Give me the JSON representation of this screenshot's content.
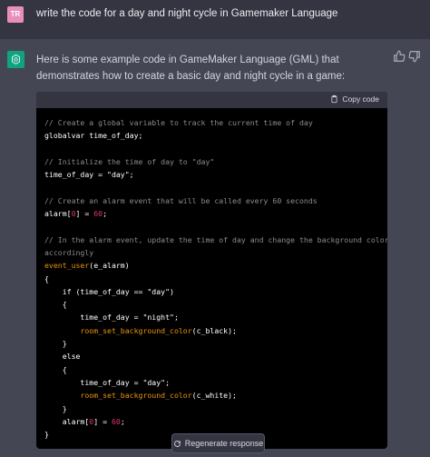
{
  "user": {
    "avatar_initials": "TR",
    "prompt": "write the code for a day and night cycle in Gamemaker Language"
  },
  "assistant": {
    "icon": "openai-logo-icon",
    "intro": "Here is some example code in GameMaker Language (GML) that demonstrates how to create a basic day and night cycle in a game:",
    "feedback": {
      "thumbs_up_icon": "thumbs-up-icon",
      "thumbs_down_icon": "thumbs-down-icon"
    }
  },
  "code_block": {
    "copy_label": "Copy code",
    "lines": [
      [
        {
          "t": "// Create a global variable to track the current time of day",
          "k": "c"
        }
      ],
      [
        {
          "t": "globalvar time_of_day;",
          "k": "p"
        }
      ],
      [
        {
          "t": "",
          "k": "p"
        }
      ],
      [
        {
          "t": "// Initialize the time of day to \"day\"",
          "k": "c"
        }
      ],
      [
        {
          "t": "time_of_day = \"day\";",
          "k": "p"
        }
      ],
      [
        {
          "t": "",
          "k": "p"
        }
      ],
      [
        {
          "t": "// Create an alarm event that will be called every 60 seconds",
          "k": "c"
        }
      ],
      [
        {
          "t": "alarm[",
          "k": "p"
        },
        {
          "t": "0",
          "k": "n"
        },
        {
          "t": "] = ",
          "k": "p"
        },
        {
          "t": "60",
          "k": "n"
        },
        {
          "t": ";",
          "k": "p"
        }
      ],
      [
        {
          "t": "",
          "k": "p"
        }
      ],
      [
        {
          "t": "// In the alarm event, update the time of day and change the background color",
          "k": "c"
        }
      ],
      [
        {
          "t": "accordingly",
          "k": "c"
        }
      ],
      [
        {
          "t": "event_user",
          "k": "f"
        },
        {
          "t": "(e_alarm)",
          "k": "p"
        }
      ],
      [
        {
          "t": "{",
          "k": "p"
        }
      ],
      [
        {
          "t": "    if (time_of_day == \"day\")",
          "k": "p"
        }
      ],
      [
        {
          "t": "    {",
          "k": "p"
        }
      ],
      [
        {
          "t": "        time_of_day = \"night\";",
          "k": "p"
        }
      ],
      [
        {
          "t": "        ",
          "k": "p"
        },
        {
          "t": "room_set_background_color",
          "k": "f"
        },
        {
          "t": "(c_black);",
          "k": "p"
        }
      ],
      [
        {
          "t": "    }",
          "k": "p"
        }
      ],
      [
        {
          "t": "    else",
          "k": "p"
        }
      ],
      [
        {
          "t": "    {",
          "k": "p"
        }
      ],
      [
        {
          "t": "        time_of_day = \"day\";",
          "k": "p"
        }
      ],
      [
        {
          "t": "        ",
          "k": "p"
        },
        {
          "t": "room_set_background_color",
          "k": "f"
        },
        {
          "t": "(c_white);",
          "k": "p"
        }
      ],
      [
        {
          "t": "    }",
          "k": "p"
        }
      ],
      [
        {
          "t": "    alarm[",
          "k": "p"
        },
        {
          "t": "0",
          "k": "n"
        },
        {
          "t": "] = ",
          "k": "p"
        },
        {
          "t": "60",
          "k": "n"
        },
        {
          "t": ";",
          "k": "p"
        }
      ],
      [
        {
          "t": "}",
          "k": "p"
        }
      ]
    ]
  },
  "regenerate_label": "Regenerate response",
  "colors": {
    "background": "#444654",
    "user_row": "#343541",
    "accent": "#10a37f",
    "number": "#df3079",
    "function": "#e9950c"
  }
}
